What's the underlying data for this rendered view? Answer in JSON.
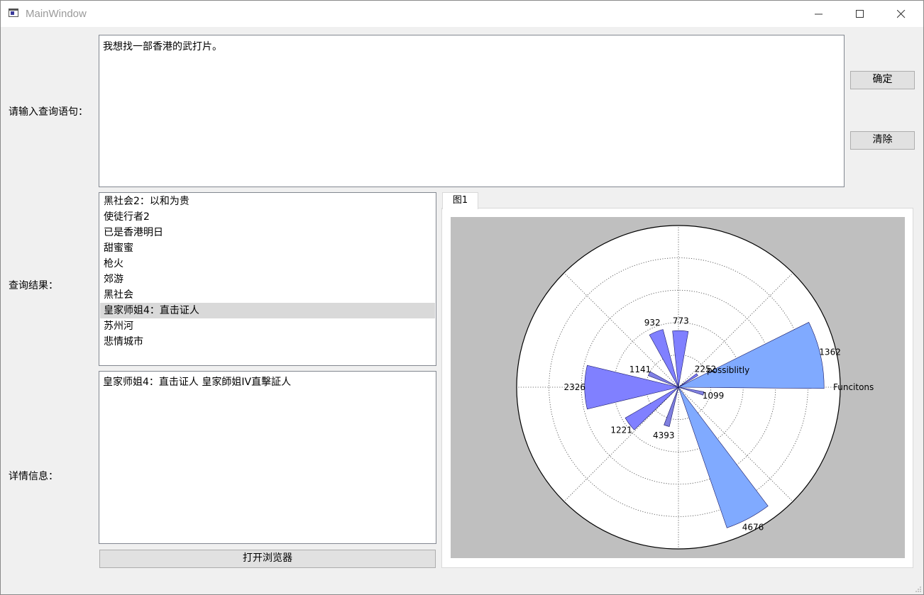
{
  "window": {
    "title": "MainWindow"
  },
  "labels": {
    "query": "请输入查询语句：",
    "results": "查询结果：",
    "details": "详情信息："
  },
  "query": {
    "value": "我想找一部香港的武打片。"
  },
  "buttons": {
    "confirm": "确定",
    "clear": "清除",
    "open_browser": "打开浏览器"
  },
  "results": {
    "items": [
      "黑社会2：以和为贵",
      "使徒行者2",
      "已是香港明日",
      "甜蜜蜜",
      "枪火",
      "郊游",
      "黑社会",
      "皇家师姐4：直击证人",
      "苏州河",
      "悲情城市"
    ],
    "selected_index": 7
  },
  "details": {
    "text": "皇家师姐4：直击证人 皇家師姐IV直擊証人"
  },
  "tabs": {
    "figure_tab": "图1"
  },
  "chart_data": {
    "type": "polar-bar",
    "r_max": 5000,
    "grid": true,
    "axis_labels": {
      "funcitons": "Funcitons",
      "possibility": "possiblitly"
    },
    "bars": [
      {
        "angle_deg": 13,
        "width_deg": 27,
        "value": 4500,
        "label": "1362",
        "color": "#80aaff"
      },
      {
        "angle_deg": 34,
        "width_deg": 6,
        "value": 700,
        "label": "2252",
        "color": "#8080ff"
      },
      {
        "angle_deg": 88,
        "width_deg": 16,
        "value": 1750,
        "label": "773",
        "color": "#8080ff"
      },
      {
        "angle_deg": 112,
        "width_deg": 14,
        "value": 1850,
        "label": "932",
        "color": "#8080ff"
      },
      {
        "angle_deg": 155,
        "width_deg": 8,
        "value": 1000,
        "label": "1141",
        "color": "#8080e6"
      },
      {
        "angle_deg": 180,
        "width_deg": 27,
        "value": 2900,
        "label": "2326",
        "color": "#8080ff"
      },
      {
        "angle_deg": 217,
        "width_deg": 14,
        "value": 1900,
        "label": "1221",
        "color": "#8080ff"
      },
      {
        "angle_deg": 253,
        "width_deg": 8,
        "value": 1250,
        "label": "4393",
        "color": "#8080e0"
      },
      {
        "angle_deg": 298,
        "width_deg": 18,
        "value": 4600,
        "label": "4676",
        "color": "#80aaff"
      },
      {
        "angle_deg": 346,
        "width_deg": 8,
        "value": 800,
        "label": "1099",
        "color": "#8080e0"
      }
    ],
    "colors": {
      "edge": "#1a1a66",
      "background": "#bfbfbf",
      "plot": "#ffffff"
    }
  }
}
